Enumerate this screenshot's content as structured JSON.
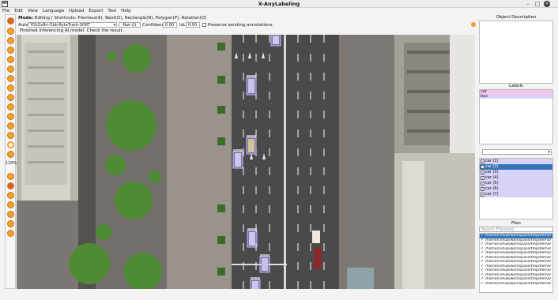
{
  "window": {
    "title": "X-AnyLabeling",
    "minimize": "–",
    "maximize": "□",
    "close": "✕"
  },
  "menu": [
    {
      "label": "File",
      "u": "F"
    },
    {
      "label": "Edit",
      "u": "E"
    },
    {
      "label": "View",
      "u": "V"
    },
    {
      "label": "Language",
      "u": "L"
    },
    {
      "label": "Upload",
      "u": "U"
    },
    {
      "label": "Export",
      "u": "E"
    },
    {
      "label": "Tool",
      "u": "T"
    },
    {
      "label": "Help",
      "u": "H"
    }
  ],
  "mode": {
    "prefix": "Mode:",
    "value": "Editing | Shortcuts: Previous(A), Next(D), Rectangle(R), Polygon(P), Rotation(O)"
  },
  "auto": {
    "label": "Auto",
    "model": "YOLOv8n-Obb-ByteTrack-SORT",
    "run_label": "Run (i)",
    "confidence_label": "Confidence",
    "confidence_value": "0.00",
    "iou_label": "IoU",
    "iou_value": "0.00",
    "preserve_label": "Preserve existing annotations",
    "status_message": "Finished inferencing AI model. Check the result."
  },
  "toolbar": {
    "zoom_value": "120%"
  },
  "object_description": {
    "title": "Object Description"
  },
  "labels": {
    "title": "Labels",
    "items": [
      "car",
      "bus"
    ],
    "colors": [
      "#f3c6ef",
      "#d9d2f7"
    ]
  },
  "shapes": [
    {
      "label": "car (1)",
      "checked": true,
      "selected": false
    },
    {
      "label": "car (2)",
      "checked": true,
      "selected": true
    },
    {
      "label": "car (3)",
      "checked": true,
      "selected": false
    },
    {
      "label": "car (4)",
      "checked": true,
      "selected": false
    },
    {
      "label": "car (5)",
      "checked": true,
      "selected": false
    },
    {
      "label": "car (6)",
      "checked": true,
      "selected": false
    },
    {
      "label": "car (7)",
      "checked": true,
      "selected": false
    }
  ],
  "files": {
    "title": "Files",
    "search_placeholder": "Search Filename",
    "items": [
      "/home/cvhub/workspace/tmp/demo/",
      "/home/cvhub/workspace/tmp/demo/",
      "/home/cvhub/workspace/tmp/demo/",
      "/home/cvhub/workspace/tmp/demo/",
      "/home/cvhub/workspace/tmp/demo/",
      "/home/cvhub/workspace/tmp/demo/",
      "/home/cvhub/workspace/tmp/demo/",
      "/home/cvhub/workspace/tmp/demo/",
      "/home/cvhub/workspace/tmp/demo/",
      "/home/cvhub/workspace/tmp/demo/",
      "/home/cvhub/workspace/tmp/demo/",
      "/home/cvhub/workspace/tmp/demo/"
    ]
  },
  "colors": {
    "accent": "#3375b8",
    "tool_orange": "#f2a22c",
    "box_purple": "#b8a8ff"
  }
}
